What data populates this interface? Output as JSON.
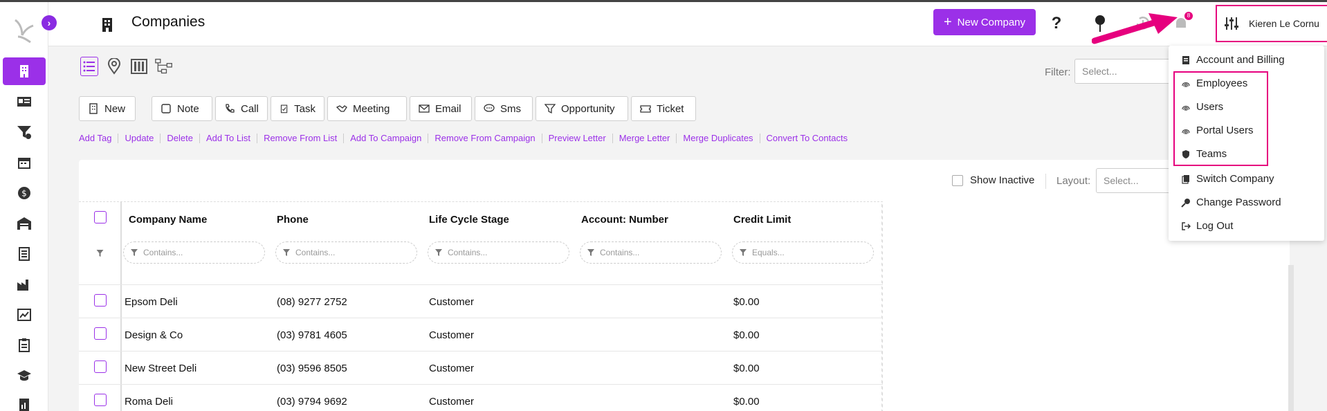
{
  "header": {
    "title": "Companies",
    "new_company_label": "New Company",
    "help_label": "?",
    "user_name": "Kieren Le Cornu",
    "badge_count": "8"
  },
  "filter": {
    "label": "Filter:",
    "placeholder": "Select..."
  },
  "actions": [
    "New",
    "Note",
    "Call",
    "Task",
    "Meeting",
    "Email",
    "Sms",
    "Opportunity",
    "Ticket"
  ],
  "bulk_links": [
    "Add Tag",
    "Update",
    "Delete",
    "Add To List",
    "Remove From List",
    "Add To Campaign",
    "Remove From Campaign",
    "Preview Letter",
    "Merge Letter",
    "Merge Duplicates",
    "Convert To Contacts"
  ],
  "grid": {
    "show_inactive_label": "Show Inactive",
    "layout_label": "Layout:",
    "layout_placeholder": "Select...",
    "columns": [
      "Company Name",
      "Phone",
      "Life Cycle Stage",
      "Account: Number",
      "Credit Limit"
    ],
    "filter_placeholders": [
      "Contains...",
      "Contains...",
      "Contains...",
      "Contains...",
      "Equals..."
    ],
    "rows": [
      {
        "name": "Epsom Deli",
        "phone": "(08) 9277 2752",
        "stage": "Customer",
        "account": "",
        "credit": "$0.00"
      },
      {
        "name": "Design & Co",
        "phone": "(03) 9781 4605",
        "stage": "Customer",
        "account": "",
        "credit": "$0.00"
      },
      {
        "name": "New Street Deli",
        "phone": "(03) 9596 8505",
        "stage": "Customer",
        "account": "",
        "credit": "$0.00"
      },
      {
        "name": "Roma Deli",
        "phone": "(03) 9794 9692",
        "stage": "Customer",
        "account": "",
        "credit": "$0.00"
      }
    ]
  },
  "user_menu": {
    "items": [
      "Account and Billing",
      "Employees",
      "Users",
      "Portal Users",
      "Teams",
      "Switch Company",
      "Change Password",
      "Log Out"
    ]
  },
  "colors": {
    "accent": "#9b30e8",
    "annotation": "#e6007e"
  }
}
